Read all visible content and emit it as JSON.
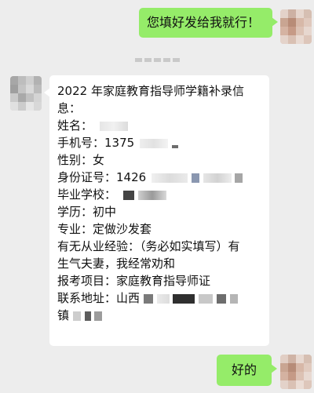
{
  "conversation": {
    "outgoing_1": "您填好发给我就行！",
    "incoming_lines": [
      "2022 年家庭教育指导师学籍补录信",
      "息：",
      "姓名：",
      "手机号：1375",
      "性别：女",
      "身份证号：1426",
      "毕业学校：",
      "学历：初中",
      "专业：定做沙发套",
      "有无从业经验：（务必如实填写）有",
      "生气夫妻，我经常劝和",
      "报考项目：家庭教育指导师证",
      "联系地址：山西",
      "镇"
    ],
    "outgoing_2": "好的"
  },
  "colors": {
    "background": "#ededed",
    "outgoing_bubble": "#95ec69",
    "incoming_bubble": "#ffffff"
  }
}
